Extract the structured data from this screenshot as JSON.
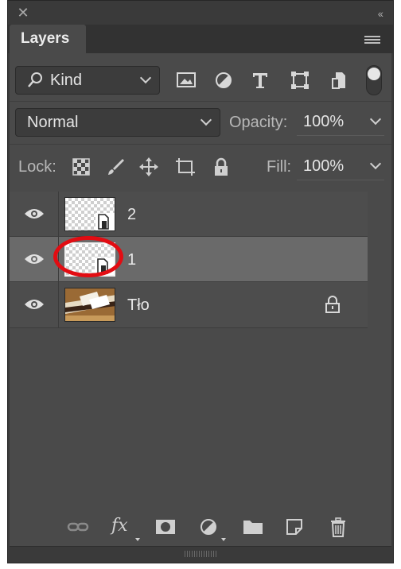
{
  "window": {
    "close_icon": "close-icon",
    "collapse_glyph": "‹‹"
  },
  "tabs": [
    {
      "label": "Layers"
    }
  ],
  "filter": {
    "kind_label": "Kind",
    "icons": [
      "image-filter-icon",
      "adjustment-filter-icon",
      "type-filter-icon",
      "shape-filter-icon",
      "smart-object-filter-icon"
    ]
  },
  "blend": {
    "mode": "Normal",
    "opacity_label": "Opacity:",
    "opacity_value": "100%"
  },
  "lock": {
    "label": "Lock:",
    "icons": [
      "lock-transparent-pixels-icon",
      "lock-image-pixels-icon",
      "lock-position-icon",
      "artboard-lock-icon",
      "lock-all-icon"
    ],
    "fill_label": "Fill:",
    "fill_value": "100%"
  },
  "layers": [
    {
      "name": "2",
      "type": "smart-object",
      "visible": true,
      "selected": false,
      "locked": false
    },
    {
      "name": "1",
      "type": "smart-object",
      "visible": true,
      "selected": true,
      "locked": false
    },
    {
      "name": "Tło",
      "type": "photo",
      "visible": true,
      "selected": false,
      "locked": true
    }
  ],
  "bottom_toolbar": {
    "fx_label": "fx",
    "icons": [
      "link-layers-icon",
      "layer-style-icon",
      "add-mask-icon",
      "new-adjustment-icon",
      "new-group-icon",
      "new-layer-icon",
      "delete-icon"
    ]
  },
  "colors": {
    "panel": "#4a4a4a",
    "selected_row": "#6a6a6a",
    "highlight_ring": "#e20c12"
  }
}
